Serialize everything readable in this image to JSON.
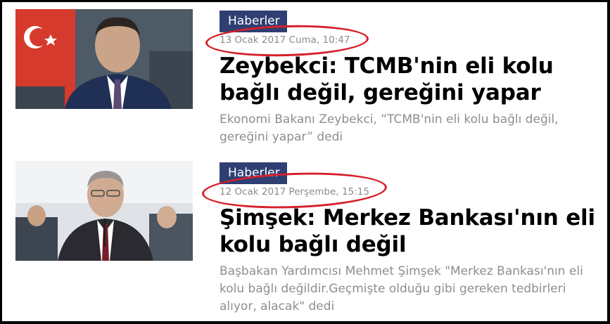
{
  "articles": [
    {
      "category": "Haberler",
      "date": "13 Ocak 2017 Cuma, 10:47",
      "headline": "Zeybekci: TCMB'nin eli kolu bağlı değil, gereğini yapar",
      "summary": "Ekonomi Bakanı Zeybekci, “TCMB'nin eli kolu bağlı değil, gereğini yapar” dedi"
    },
    {
      "category": "Haberler",
      "date": "12 Ocak 2017 Perşembe, 15:15",
      "headline": "Şimşek: Merkez Bankası'nın eli kolu bağlı değil",
      "summary": "Başbakan Yardımcısı Mehmet Şimşek \"Merkez Bankası'nın eli kolu bağlı değildir.Geçmişte olduğu gibi gereken tedbirleri alıyor, alacak\" dedi"
    }
  ],
  "colors": {
    "category_bg": "#2f3f73",
    "annotation": "#d5202a",
    "date_text": "#8b8b8b",
    "summary_text": "#8e8e8e"
  }
}
